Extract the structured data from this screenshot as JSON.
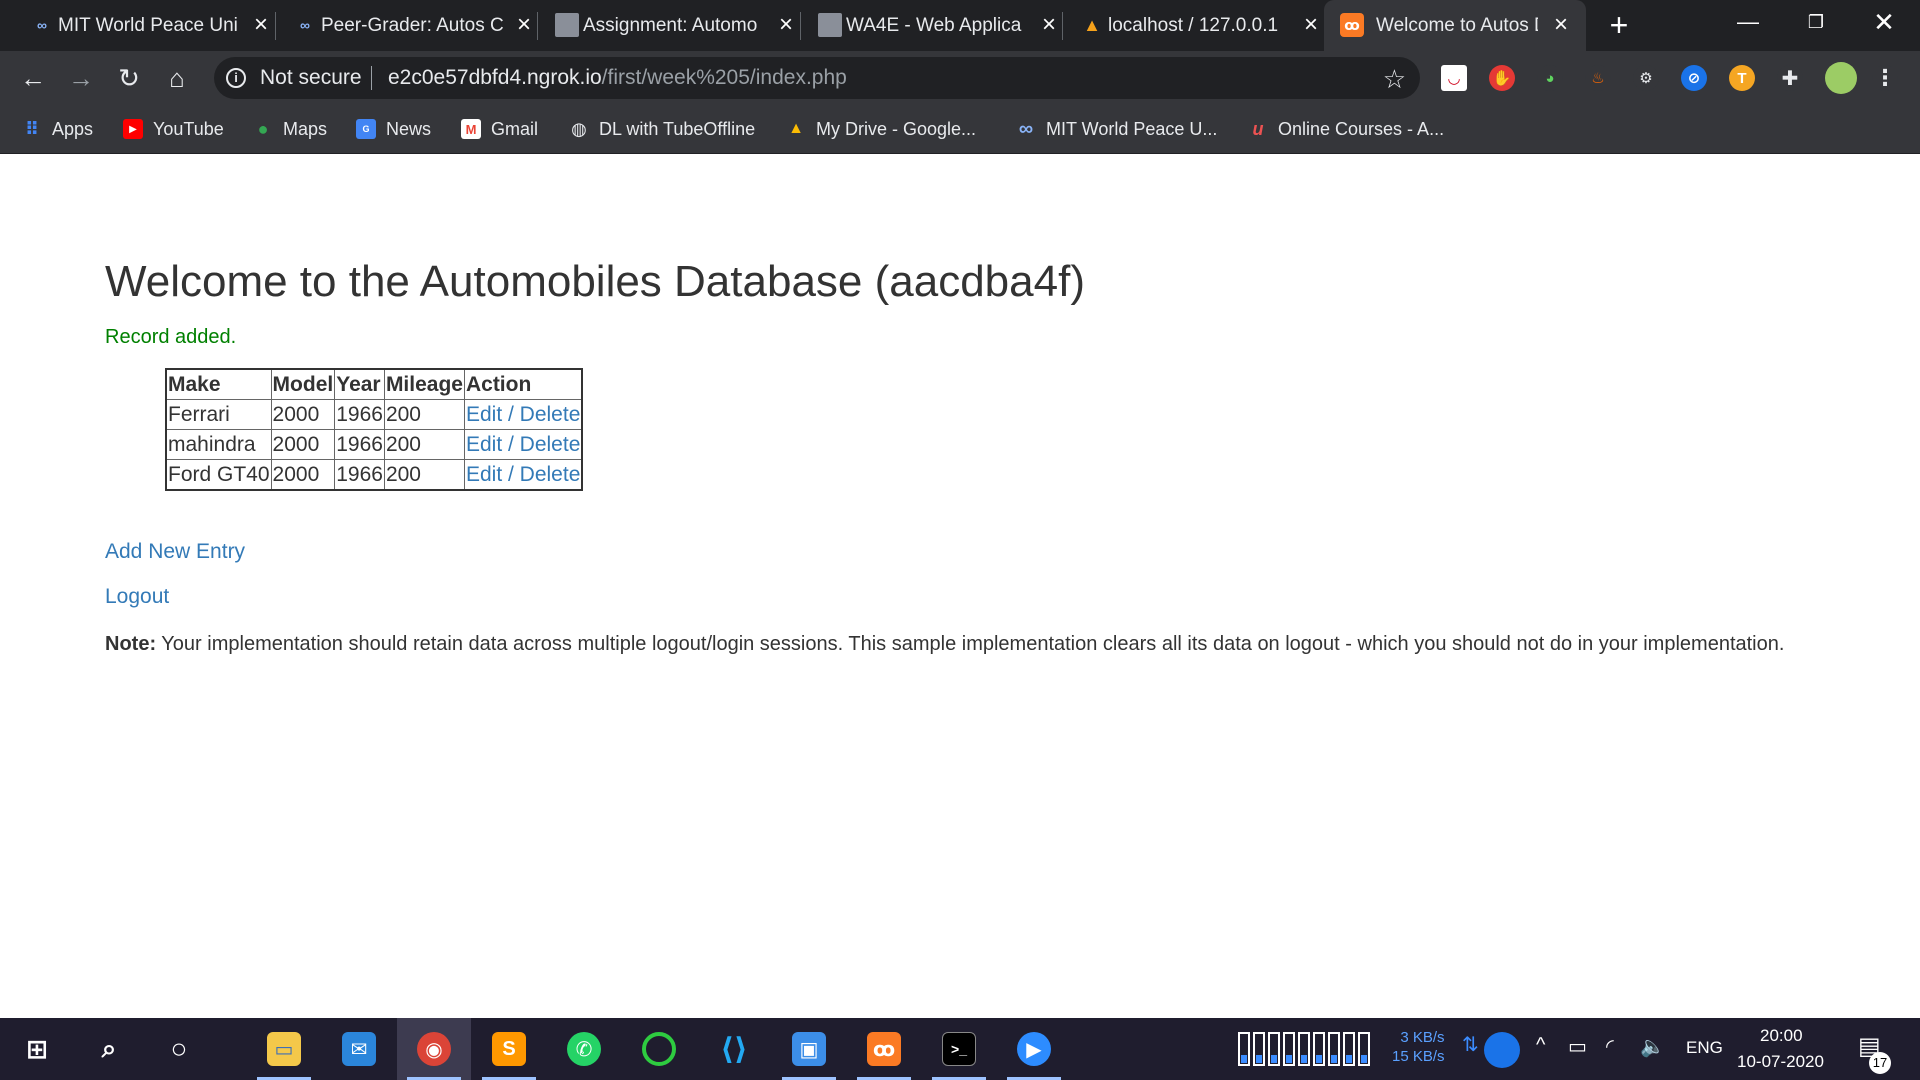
{
  "browser": {
    "tabs": [
      {
        "title": "MIT World Peace Uni",
        "favicon": "infinity-icon",
        "active": false
      },
      {
        "title": "Peer-Grader: Autos C",
        "favicon": "infinity-icon",
        "active": false
      },
      {
        "title": "Assignment: Automo",
        "favicon": "avatar-icon",
        "active": false
      },
      {
        "title": "WA4E - Web Applica",
        "favicon": "avatar-icon",
        "active": false
      },
      {
        "title": "localhost / 127.0.0.1",
        "favicon": "phpmyadmin-icon",
        "active": false
      },
      {
        "title": "Welcome to Autos D",
        "favicon": "xampp-icon",
        "active": true
      }
    ],
    "omnibox": {
      "security_label": "Not secure",
      "url_host": "e2c0e57dbfd4.ngrok.io",
      "url_path": "/first/week%205/index.php"
    },
    "bookmarks": [
      {
        "label": "Apps",
        "icon": "apps-grid-icon"
      },
      {
        "label": "YouTube",
        "icon": "youtube-icon"
      },
      {
        "label": "Maps",
        "icon": "maps-pin-icon"
      },
      {
        "label": "News",
        "icon": "news-icon"
      },
      {
        "label": "Gmail",
        "icon": "gmail-icon"
      },
      {
        "label": "DL with TubeOffline",
        "icon": "globe-icon"
      },
      {
        "label": "My Drive - Google...",
        "icon": "drive-icon"
      },
      {
        "label": "MIT World Peace U...",
        "icon": "infinity-icon"
      },
      {
        "label": "Online Courses - A...",
        "icon": "udemy-icon"
      }
    ]
  },
  "page": {
    "title": "Welcome to the Automobiles Database (aacdba4f)",
    "flash": "Record added.",
    "table": {
      "headers": [
        "Make",
        "Model",
        "Year",
        "Mileage",
        "Action"
      ],
      "rows": [
        {
          "make": "Ferrari",
          "model": "2000",
          "year": "1966",
          "mileage": "200",
          "edit": "Edit",
          "sep": " / ",
          "delete": "Delete"
        },
        {
          "make": "mahindra",
          "model": "2000",
          "year": "1966",
          "mileage": "200",
          "edit": "Edit",
          "sep": " / ",
          "delete": "Delete"
        },
        {
          "make": "Ford GT40",
          "model": "2000",
          "year": "1966",
          "mileage": "200",
          "edit": "Edit",
          "sep": " / ",
          "delete": "Delete"
        }
      ]
    },
    "add_link": "Add New Entry",
    "logout_link": "Logout",
    "note_label": "Note:",
    "note_text": " Your implementation should retain data across multiple logout/login sessions. This sample implementation clears all its data on logout - which you should not do in your implementation."
  },
  "taskbar": {
    "net_up": "3 KB/s",
    "net_down": "15 KB/s",
    "language": "ENG",
    "time": "20:00",
    "date": "10-07-2020",
    "notification_count": "17"
  }
}
